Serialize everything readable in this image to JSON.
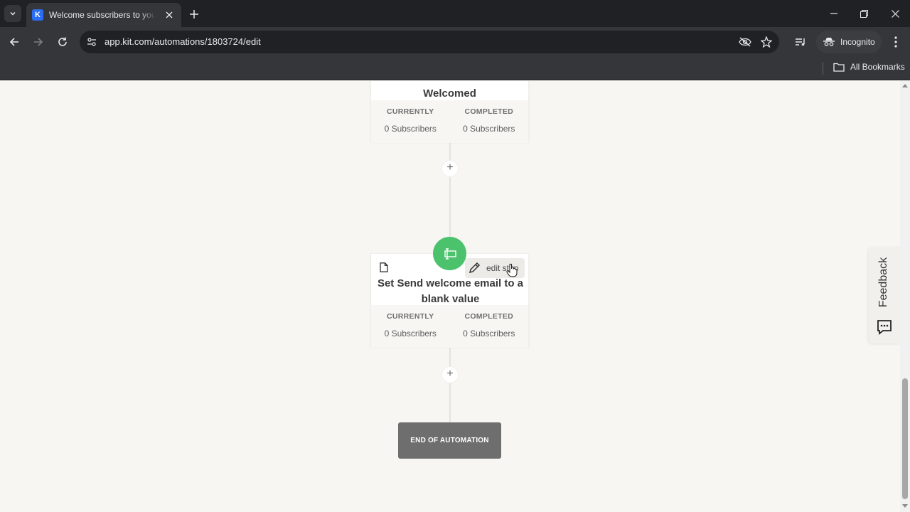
{
  "browser": {
    "tab_title": "Welcome subscribers to your p",
    "favicon_letter": "K",
    "url": "app.kit.com/automations/1803724/edit",
    "incognito_label": "Incognito",
    "all_bookmarks_label": "All Bookmarks",
    "icons": [
      "tab-search-icon",
      "close-icon",
      "new-tab-icon",
      "minimize-icon",
      "restore-icon",
      "window-close-icon",
      "back-icon",
      "forward-icon",
      "reload-icon",
      "site-info-icon",
      "eye-off-icon",
      "star-icon",
      "media-icon",
      "incognito-icon",
      "more-icon",
      "folder-icon"
    ]
  },
  "automation": {
    "welcomed_step": {
      "title": "Welcomed",
      "currently_label": "CURRENTLY",
      "currently_value": "0 Subscribers",
      "completed_label": "COMPLETED",
      "completed_value": "0 Subscribers"
    },
    "action_step": {
      "title": "Set Send welcome email to a blank value",
      "edit_label": "edit step",
      "currently_label": "CURRENTLY",
      "currently_value": "0 Subscribers",
      "completed_label": "COMPLETED",
      "completed_value": "0 Subscribers",
      "badge_color": "#4cc26d"
    },
    "add_step_symbol": "+",
    "end_label": "END OF AUTOMATION"
  },
  "feedback": {
    "label": "Feedback"
  }
}
